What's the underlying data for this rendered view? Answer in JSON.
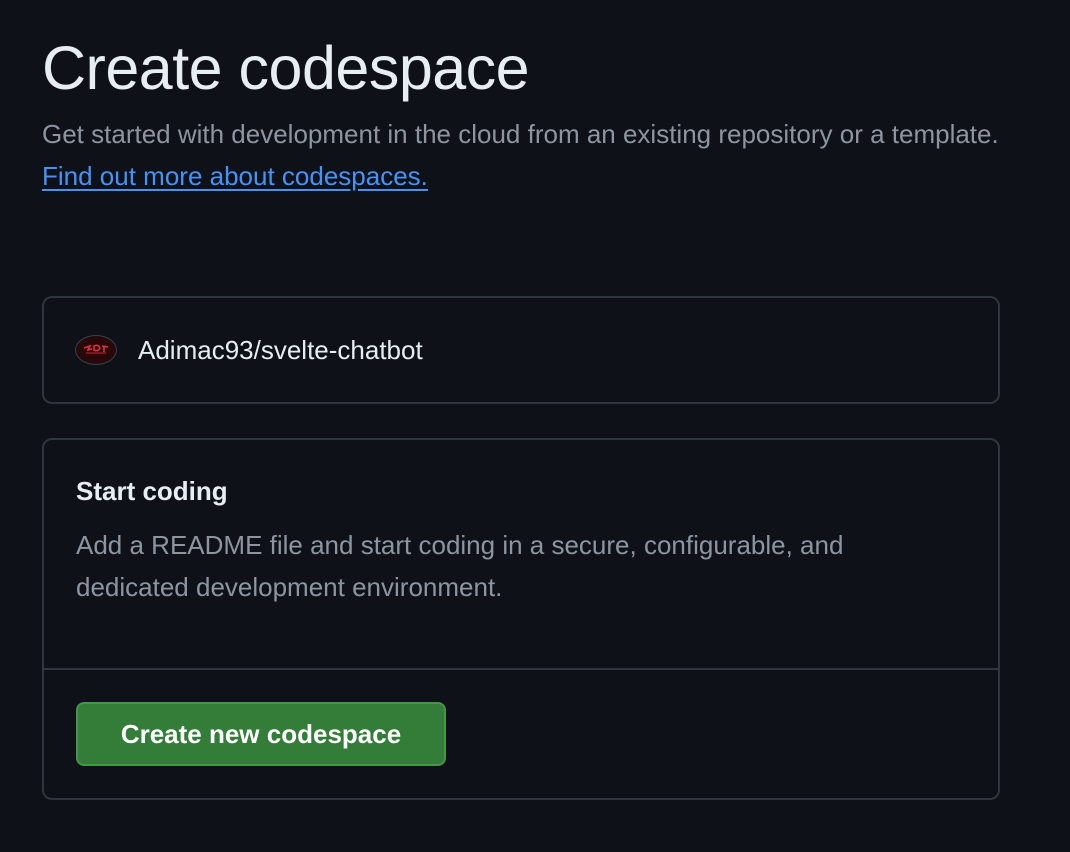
{
  "header": {
    "title": "Create codespace",
    "intro_text": "Get started with development in the cloud from an existing repository or a template.",
    "learn_more_link": "Find out more about codespaces."
  },
  "repository": {
    "name": "Adimac93/svelte-chatbot",
    "avatar_icon": "repo-owner-avatar"
  },
  "start_coding": {
    "title": "Start coding",
    "description": "Add a README file and start coding in a secure, configurable, and dedicated development environment.",
    "button_label": "Create new codespace"
  },
  "colors": {
    "background": "#0e1117",
    "border": "#30363d",
    "link": "#4493f8",
    "button": "#347d39"
  }
}
